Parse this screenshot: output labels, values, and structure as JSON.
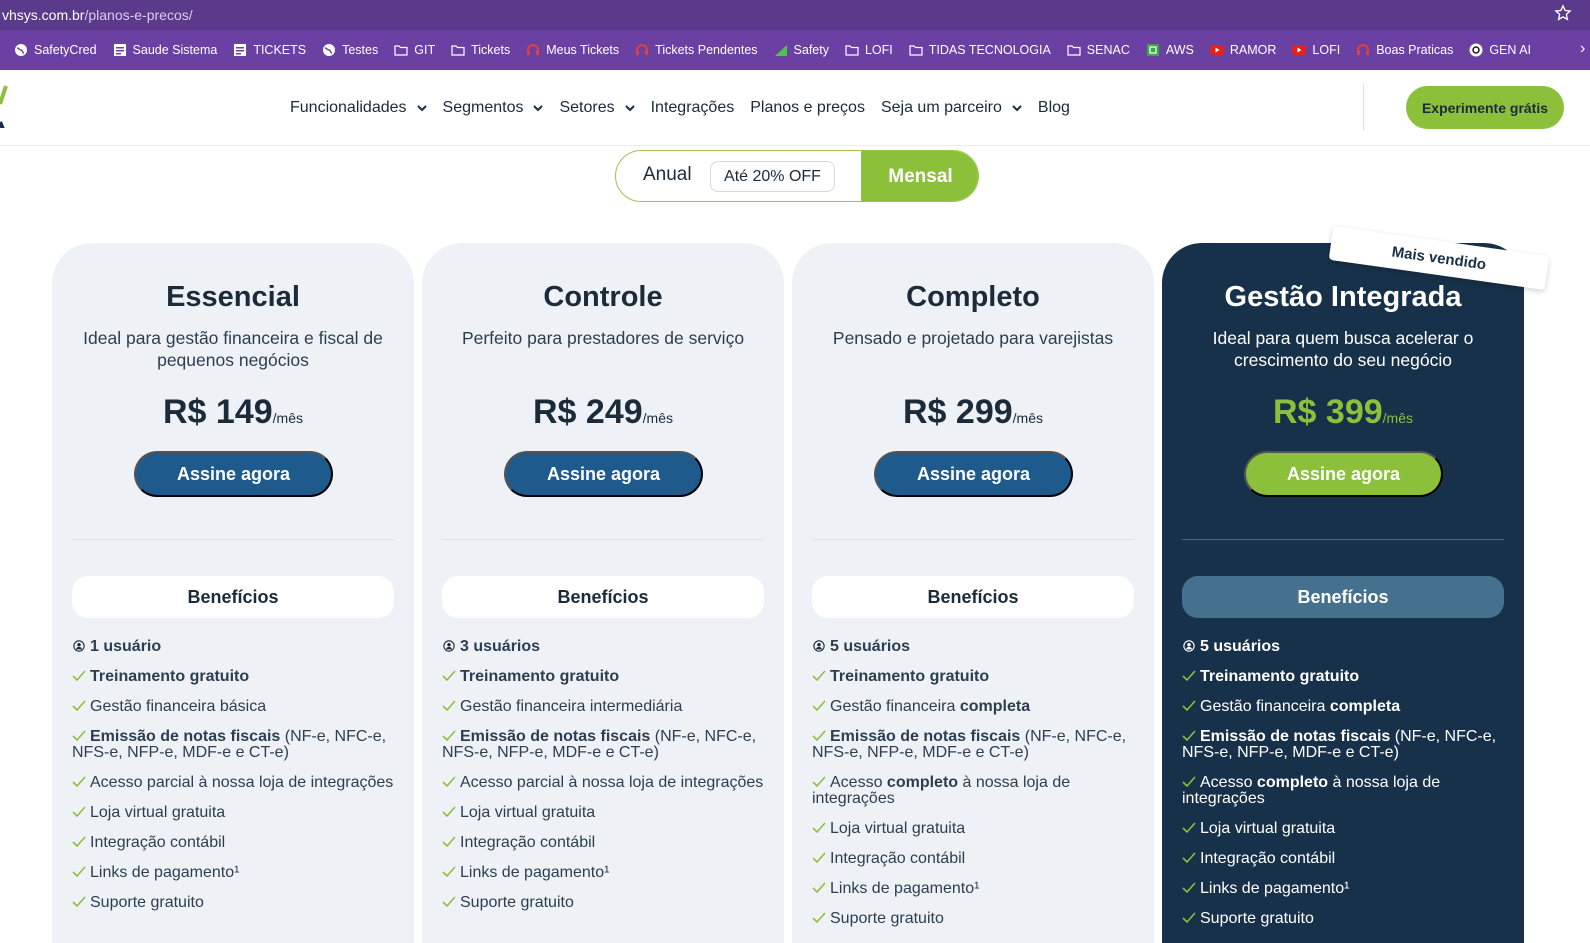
{
  "browser": {
    "url_domain": "vhsys.com.br",
    "url_path": "/planos-e-precos/",
    "bookmarks": [
      {
        "label": "SafetyCred",
        "icon": "globe-icon"
      },
      {
        "label": "Saude Sistema",
        "icon": "page-icon"
      },
      {
        "label": "TICKETS",
        "icon": "page-icon"
      },
      {
        "label": "Testes",
        "icon": "globe-icon"
      },
      {
        "label": "GIT",
        "icon": "folder-icon"
      },
      {
        "label": "Tickets",
        "icon": "folder-icon"
      },
      {
        "label": "Meus Tickets",
        "icon": "headset-icon"
      },
      {
        "label": "Tickets Pendentes",
        "icon": "headset-icon"
      },
      {
        "label": "Safety",
        "icon": "chart-icon"
      },
      {
        "label": "LOFI",
        "icon": "folder-icon"
      },
      {
        "label": "TIDAS TECNOLOGIA",
        "icon": "folder-icon"
      },
      {
        "label": "SENAC",
        "icon": "folder-icon"
      },
      {
        "label": "AWS",
        "icon": "aws-icon"
      },
      {
        "label": "RAMOR",
        "icon": "youtube-icon"
      },
      {
        "label": "LOFI",
        "icon": "youtube-icon"
      },
      {
        "label": "Boas Praticas",
        "icon": "headset-icon"
      },
      {
        "label": "GEN AI",
        "icon": "openai-icon"
      }
    ]
  },
  "header": {
    "nav": [
      {
        "label": "Funcionalidades",
        "dropdown": true
      },
      {
        "label": "Segmentos",
        "dropdown": true
      },
      {
        "label": "Setores",
        "dropdown": true
      },
      {
        "label": "Integrações",
        "dropdown": false
      },
      {
        "label": "Planos e preços",
        "dropdown": false
      },
      {
        "label": "Seja um parceiro",
        "dropdown": true
      },
      {
        "label": "Blog",
        "dropdown": false
      }
    ],
    "cta_label": "Experimente grátis"
  },
  "billing_toggle": {
    "anual_label": "Anual",
    "discount_label": "Até 20% OFF",
    "mensal_label": "Mensal",
    "selected": "Mensal"
  },
  "colors": {
    "accent_green": "#8cc03a",
    "primary_blue": "#1e5a8c",
    "dark_card": "#17314a",
    "light_card": "#eef2f7"
  },
  "badge_label": "Mais vendido",
  "plans": [
    {
      "title": "Essencial",
      "subtitle": "Ideal para gestão financeira e fiscal de pequenos negócios",
      "price": "R$ 149",
      "per": "/mês",
      "button": "Assine agora",
      "benefits_label": "Benefícios",
      "users": "1 usuário",
      "features": [
        [
          {
            "t": "Treinamento gratuito",
            "b": true
          }
        ],
        [
          {
            "t": "Gestão financeira básica",
            "b": false
          }
        ],
        [
          {
            "t": "Emissão de notas fiscais",
            "b": true
          },
          {
            "t": " (NF-e, NFC-e, NFS-e, NFP-e, MDF-e e CT-e)",
            "b": false
          }
        ],
        [
          {
            "t": "Acesso parcial à nossa loja de integrações",
            "b": false
          }
        ],
        [
          {
            "t": "Loja virtual gratuita",
            "b": false
          }
        ],
        [
          {
            "t": "Integração contábil",
            "b": false
          }
        ],
        [
          {
            "t": "Links de pagamento¹",
            "b": false
          }
        ],
        [
          {
            "t": "Suporte gratuito",
            "b": false
          }
        ]
      ]
    },
    {
      "title": "Controle",
      "subtitle": "Perfeito para prestadores de serviço",
      "price": "R$ 249",
      "per": "/mês",
      "button": "Assine agora",
      "benefits_label": "Benefícios",
      "users": "3 usuários",
      "features": [
        [
          {
            "t": "Treinamento gratuito",
            "b": true
          }
        ],
        [
          {
            "t": "Gestão financeira intermediária",
            "b": false
          }
        ],
        [
          {
            "t": "Emissão de notas fiscais",
            "b": true
          },
          {
            "t": " (NF-e, NFC-e, NFS-e, NFP-e, MDF-e e CT-e)",
            "b": false
          }
        ],
        [
          {
            "t": "Acesso parcial à nossa loja de integrações",
            "b": false
          }
        ],
        [
          {
            "t": "Loja virtual gratuita",
            "b": false
          }
        ],
        [
          {
            "t": "Integração contábil",
            "b": false
          }
        ],
        [
          {
            "t": "Links de pagamento¹",
            "b": false
          }
        ],
        [
          {
            "t": "Suporte gratuito",
            "b": false
          }
        ]
      ]
    },
    {
      "title": "Completo",
      "subtitle": "Pensado e projetado para varejistas",
      "price": "R$ 299",
      "per": "/mês",
      "button": "Assine agora",
      "benefits_label": "Benefícios",
      "users": "5 usuários",
      "features": [
        [
          {
            "t": "Treinamento gratuito",
            "b": true
          }
        ],
        [
          {
            "t": "Gestão financeira ",
            "b": false
          },
          {
            "t": "completa",
            "b": true
          }
        ],
        [
          {
            "t": "Emissão de notas fiscais",
            "b": true
          },
          {
            "t": " (NF-e, NFC-e, NFS-e, NFP-e, MDF-e e CT-e)",
            "b": false
          }
        ],
        [
          {
            "t": "Acesso ",
            "b": false
          },
          {
            "t": "completo",
            "b": true
          },
          {
            "t": " à nossa loja de integrações",
            "b": false
          }
        ],
        [
          {
            "t": "Loja virtual gratuita",
            "b": false
          }
        ],
        [
          {
            "t": "Integração contábil",
            "b": false
          }
        ],
        [
          {
            "t": "Links de pagamento¹",
            "b": false
          }
        ],
        [
          {
            "t": "Suporte gratuito",
            "b": false
          }
        ]
      ]
    },
    {
      "title": "Gestão Integrada",
      "subtitle": "Ideal para quem busca acelerar o crescimento do seu negócio",
      "price": "R$ 399",
      "per": "/mês",
      "button": "Assine agora",
      "benefits_label": "Benefícios",
      "users": "5 usuários",
      "features": [
        [
          {
            "t": "Treinamento gratuito",
            "b": true
          }
        ],
        [
          {
            "t": "Gestão financeira ",
            "b": false
          },
          {
            "t": "completa",
            "b": true
          }
        ],
        [
          {
            "t": "Emissão de notas fiscais",
            "b": true
          },
          {
            "t": " (NF-e, NFC-e, NFS-e, NFP-e, MDF-e e CT-e)",
            "b": false
          }
        ],
        [
          {
            "t": "Acesso ",
            "b": false
          },
          {
            "t": "completo",
            "b": true
          },
          {
            "t": " à nossa loja de integrações",
            "b": false
          }
        ],
        [
          {
            "t": "Loja virtual gratuita",
            "b": false
          }
        ],
        [
          {
            "t": "Integração contábil",
            "b": false
          }
        ],
        [
          {
            "t": "Links de pagamento¹",
            "b": false
          }
        ],
        [
          {
            "t": "Suporte gratuito",
            "b": false
          }
        ]
      ]
    }
  ]
}
